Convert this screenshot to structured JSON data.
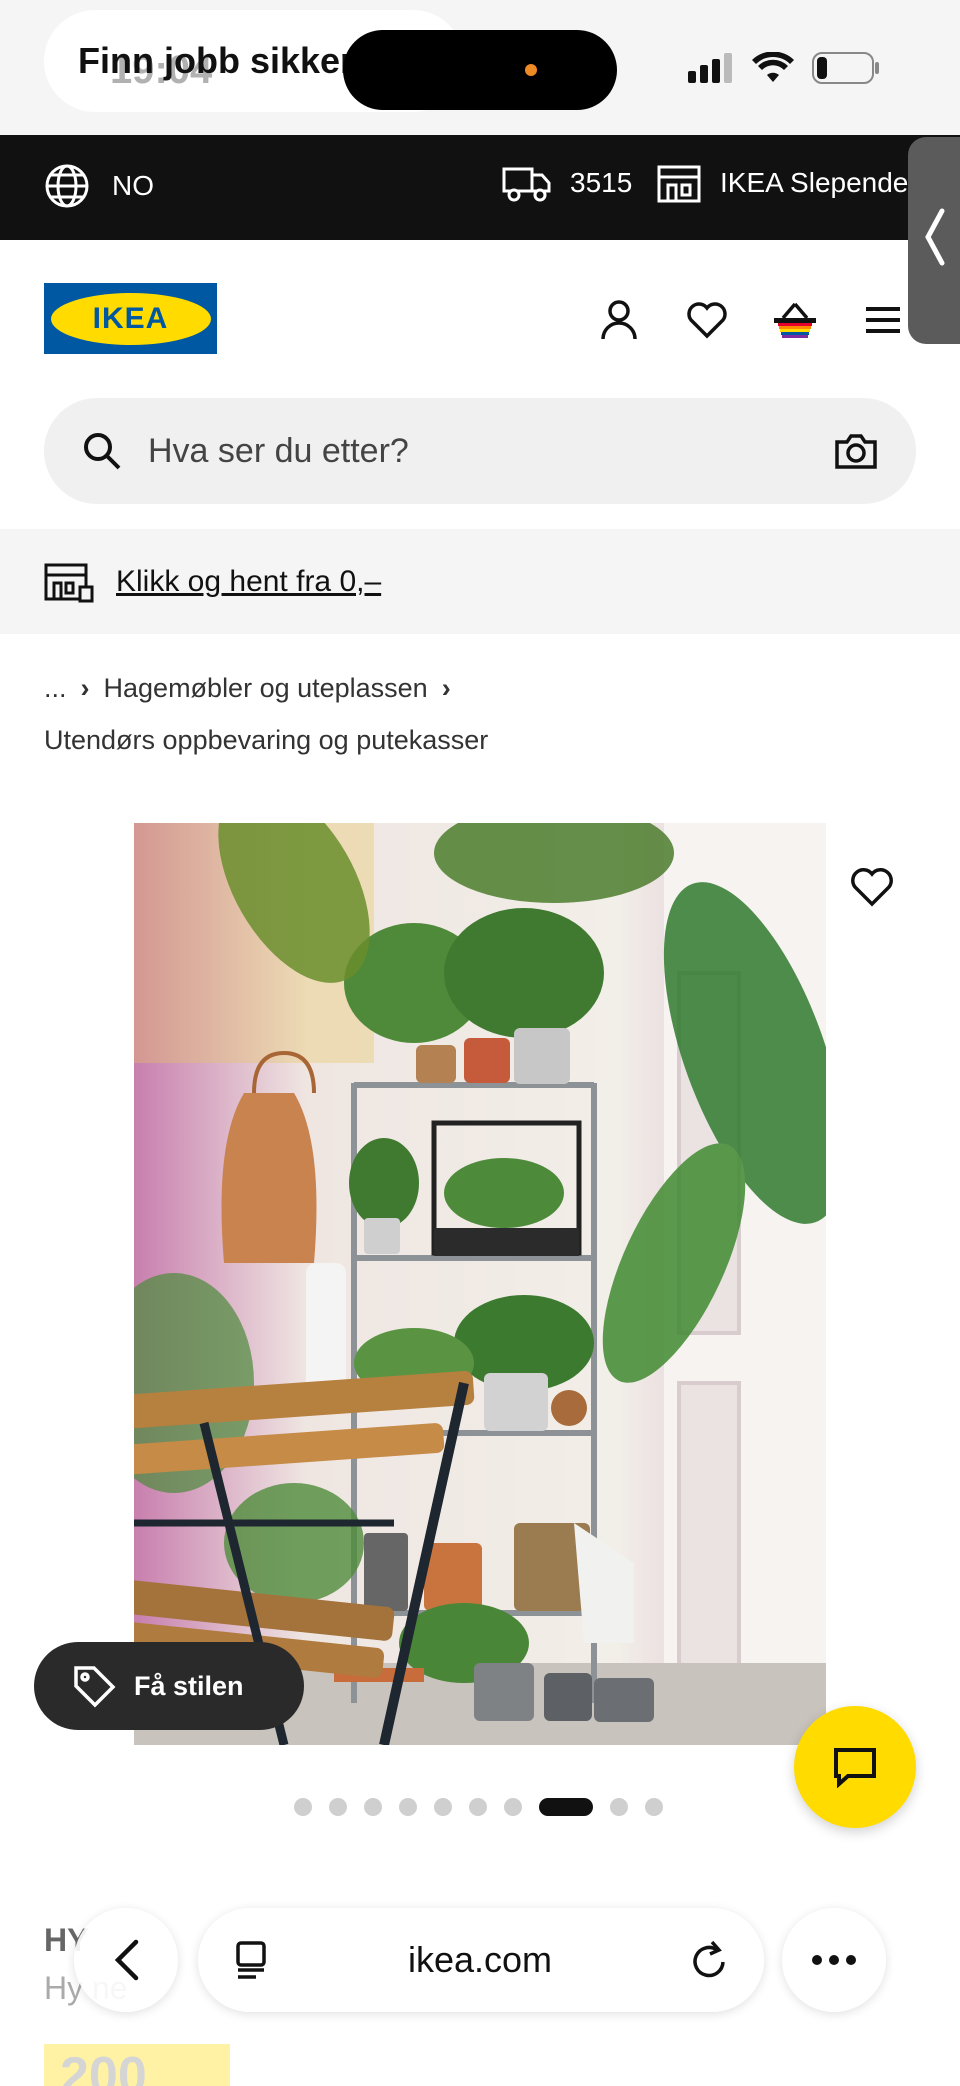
{
  "status_bar": {
    "time": "19:04",
    "notification_title": "Finn jobb sikker"
  },
  "top_bar": {
    "language": "NO",
    "postcode": "3515",
    "store": "IKEA Slependen"
  },
  "header": {
    "logo_text": "IKEA",
    "icons": [
      "user-icon",
      "heart-icon",
      "basket-icon",
      "menu-icon"
    ]
  },
  "search": {
    "placeholder": "Hva ser du etter?"
  },
  "promo": {
    "text": "Klikk og hent fra 0,–"
  },
  "breadcrumb": {
    "ellipsis": "...",
    "level1": "Hagemøbler og uteplassen",
    "level2": "Utendørs oppbevaring og putekasser"
  },
  "gallery": {
    "style_button": "Få stilen",
    "dot_count": 10,
    "active_index": 7
  },
  "product": {
    "name_partial": "HY",
    "subtitle_partial": "Hy     ne",
    "price_partial": "200"
  },
  "browser": {
    "url": "ikea.com"
  },
  "colors": {
    "ikea_blue": "#0058a3",
    "ikea_yellow": "#ffdb00",
    "top_bar": "#111111"
  }
}
